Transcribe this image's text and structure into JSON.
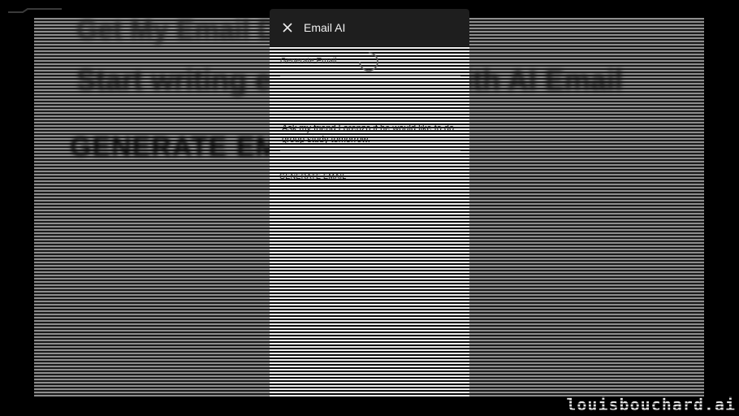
{
  "panel": {
    "title": "Email AI",
    "field_label": "Generate Email",
    "prompt_text": "Ask my friend Lorenzo if he would like to do group study tomorrow.",
    "generate_button": "GENERATE EMAIL"
  },
  "background_page": {
    "top_text": "Get My Email Done",
    "headline": "Start writing emails faster with AI Email",
    "cta_text": "GENERATE EMAIL"
  },
  "watermark": {
    "text": "louisbouchard.ai"
  },
  "icons": {
    "close": "close-icon",
    "loading": "loading-spinner-icon",
    "logo": "logo-icon"
  },
  "colors": {
    "header_bg": "#1e1e1e",
    "panel_bg": "#ededed",
    "backdrop": "#8e8e8e"
  }
}
